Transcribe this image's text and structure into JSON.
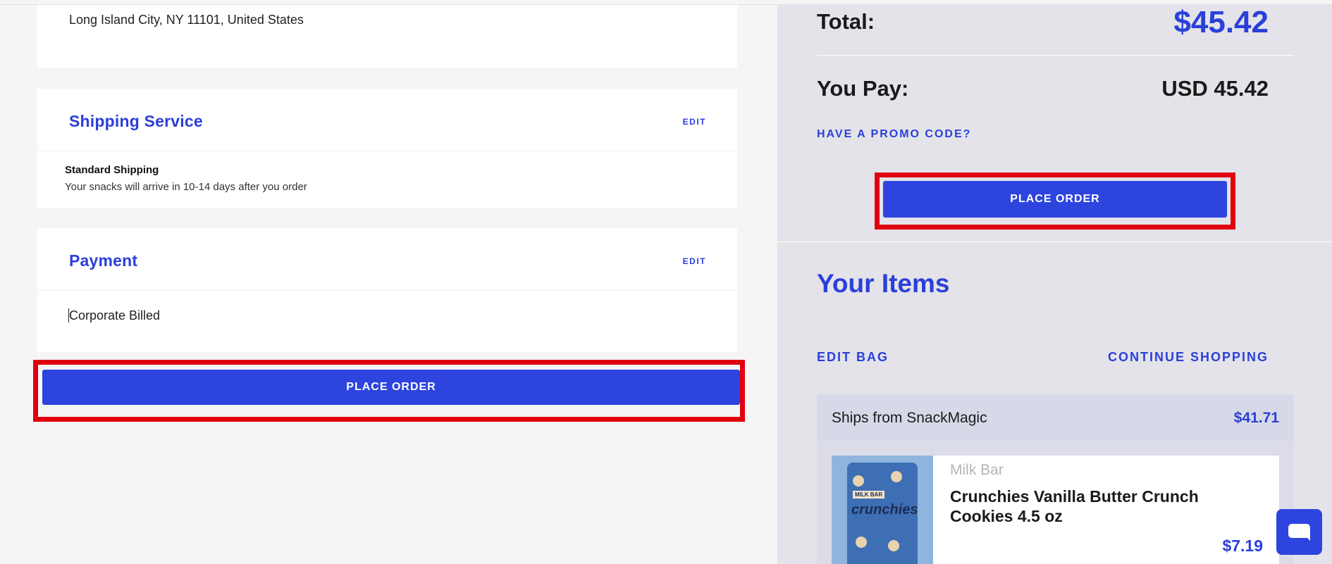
{
  "address": {
    "line": "Long Island City, NY 11101, United States"
  },
  "shipping": {
    "title": "Shipping Service",
    "edit_label": "EDIT",
    "method": "Standard Shipping",
    "description": "Your snacks will arrive in 10-14 days after you order"
  },
  "payment": {
    "title": "Payment",
    "edit_label": "EDIT",
    "method": "Corporate Billed"
  },
  "place_order_label": "PLACE ORDER",
  "summary": {
    "total_label": "Total:",
    "total_value": "$45.42",
    "you_pay_label": "You Pay:",
    "you_pay_value": "USD 45.42",
    "promo_label": "HAVE A PROMO CODE?",
    "place_order_label": "PLACE ORDER"
  },
  "items_section": {
    "title": "Your Items",
    "edit_bag_label": "EDIT BAG",
    "continue_label": "CONTINUE SHOPPING",
    "ships_from_label": "Ships from SnackMagic",
    "ships_from_amount": "$41.71",
    "items": [
      {
        "brand": "Milk Bar",
        "name": "Crunchies Vanilla Butter Crunch Cookies 4.5 oz",
        "price": "$7.19",
        "image_brand_text": "MILK BAR",
        "image_product_text": "crunchies"
      }
    ]
  },
  "colors": {
    "accent": "#2d44df",
    "highlight": "#e1000f",
    "summary_bg": "#e3e3e9"
  },
  "icons": {
    "chat": "chat-icon"
  }
}
